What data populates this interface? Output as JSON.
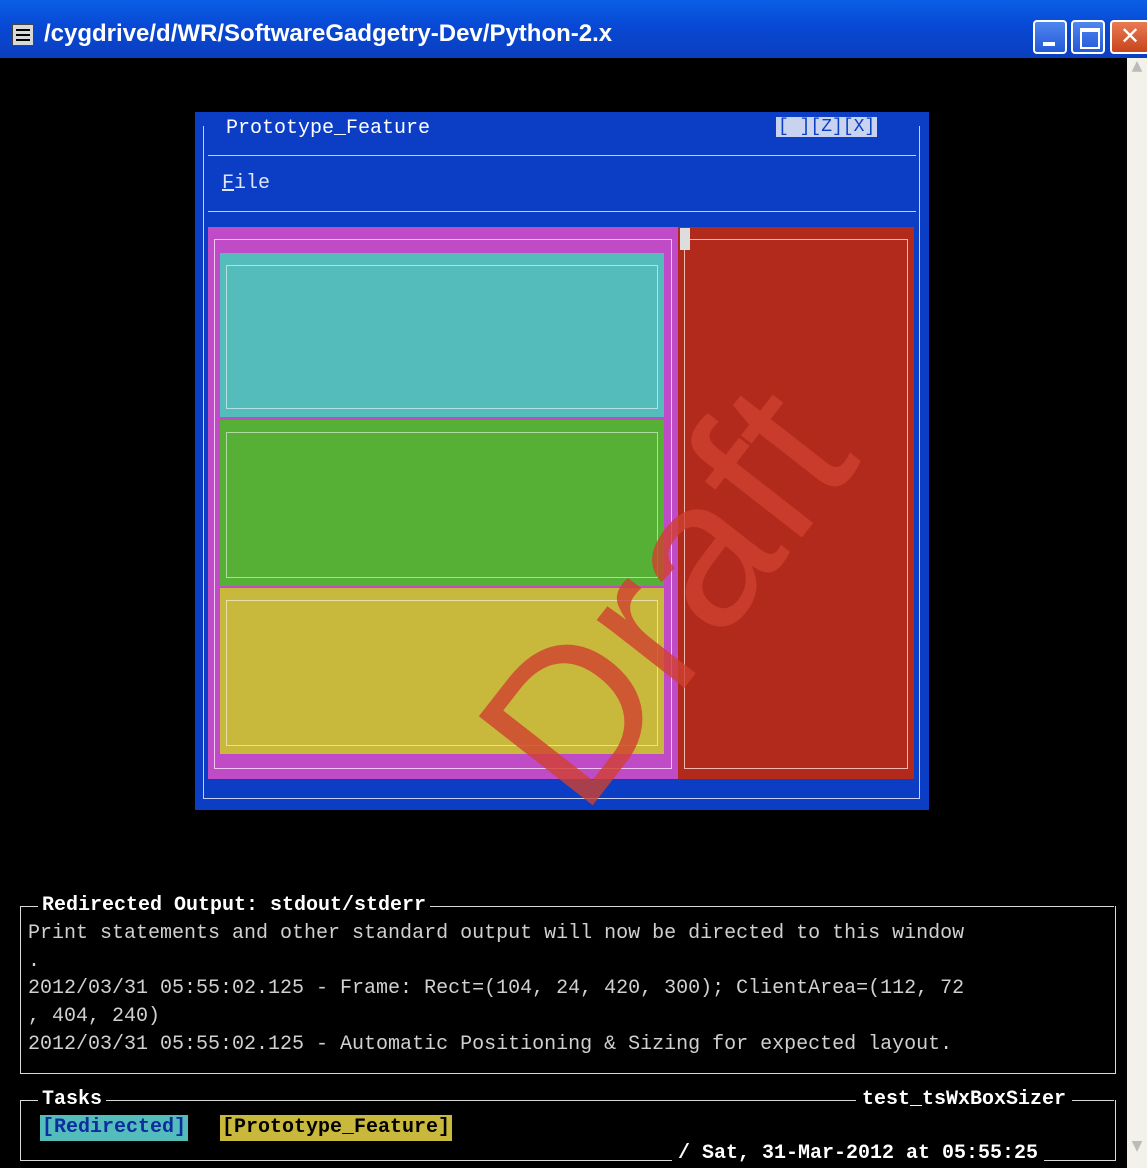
{
  "window": {
    "title": "/cygdrive/d/WR/SoftwareGadgetry-Dev/Python-2.x",
    "controls": [
      "minimize",
      "maximize",
      "close"
    ]
  },
  "frame": {
    "title": "Prototype_Feature",
    "buttons": "[ ][Z][X]",
    "menu": {
      "file_label_first": "F",
      "file_label_rest": "ile"
    },
    "panels": {
      "magenta": "#c04bc7",
      "cyan": "#55bcbc",
      "green": "#56b036",
      "yellow": "#c8b93d",
      "red": "#b12a1c"
    }
  },
  "watermark": "Draft",
  "output": {
    "title": "Redirected Output: stdout/stderr",
    "lines": [
      "Print statements and other standard output will now be directed to this window",
      ".",
      "2012/03/31 05:55:02.125 - Frame: Rect=(104, 24, 420, 300); ClientArea=(112, 72",
      ", 404, 240)",
      "2012/03/31 05:55:02.125 - Automatic Positioning & Sizing for expected layout."
    ]
  },
  "tasks": {
    "title": "Tasks",
    "app_name": "test_tsWxBoxSizer",
    "items": [
      "[Redirected]",
      "[Prototype_Feature]"
    ],
    "status": "/ Sat, 31-Mar-2012 at 05:55:25"
  }
}
